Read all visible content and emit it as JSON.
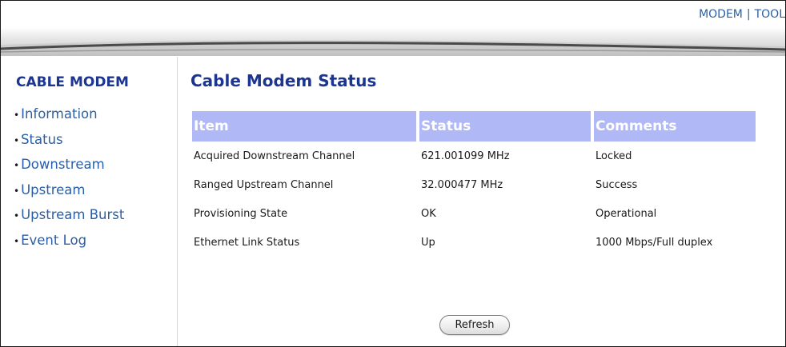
{
  "topnav": {
    "modem_link": "MODEM",
    "separator": "|",
    "tools_link": "TOOL"
  },
  "sidebar": {
    "title": "CABLE MODEM",
    "items": [
      {
        "label": "Information"
      },
      {
        "label": "Status"
      },
      {
        "label": "Downstream"
      },
      {
        "label": "Upstream"
      },
      {
        "label": "Upstream Burst"
      },
      {
        "label": "Event Log"
      }
    ]
  },
  "main": {
    "title": "Cable Modem Status",
    "table": {
      "headers": [
        "Item",
        "Status",
        "Comments"
      ],
      "rows": [
        [
          "Acquired Downstream Channel",
          "621.001099 MHz",
          "Locked"
        ],
        [
          "Ranged Upstream Channel",
          "32.000477 MHz",
          "Success"
        ],
        [
          "Provisioning State",
          "OK",
          "Operational"
        ],
        [
          "Ethernet Link Status",
          "Up",
          "1000 Mbps/Full duplex"
        ]
      ]
    },
    "refresh_label": "Refresh"
  },
  "colors": {
    "heading": "#1b3591",
    "link": "#2a5fa8",
    "table_header_bg": "#b0b8f5"
  },
  "icons": [
    "bullet-icon"
  ]
}
